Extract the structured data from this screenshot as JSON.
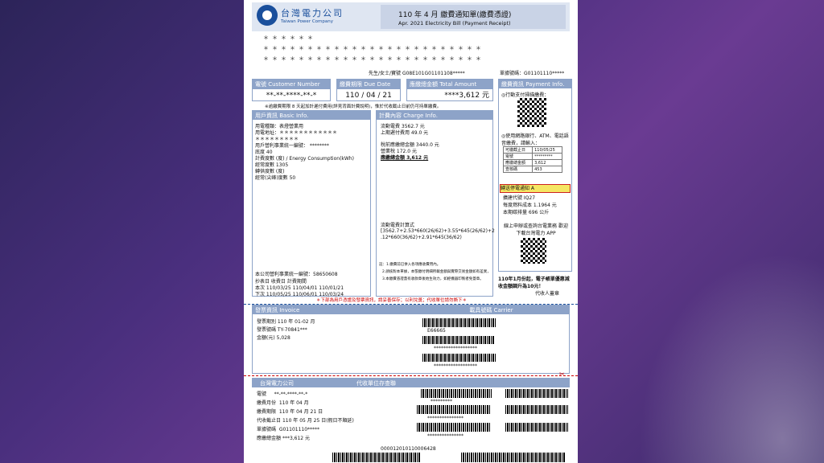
{
  "company": {
    "name_zh": "台灣電力公司",
    "name_en": "Taiwan Power Company"
  },
  "header": {
    "line1": "110 年  4 月      繳費通知單(繳費憑證)",
    "line2": "Apr. 2021 Electricity Bill (Payment Receipt)"
  },
  "stars_row1": "＊＊＊＊＊＊",
  "stars_row2": "＊＊＊＊＊＊＊＊＊＊＊＊＊＊＊＊＊＊＊＊＊＊＊＊＊",
  "stars_row3": "＊＊＊＊＊＊＊＊＊＊＊＊＊＊＊＊＊＊＊＊＊＊＊＊＊",
  "customer_line": "先生/女士/寶號   G08E101G01101108*****",
  "bill_no": "單據號碼：G01101110*****",
  "top_fields": {
    "account_label": "電號 Customer Number",
    "account_value": "**-**-****-**-*",
    "due_label": "繳費期限 Due Date",
    "due_value": "110 / 04 / 21",
    "total_label": "應繳總金額 Total Amount",
    "total_value": "****3,612 元"
  },
  "notice": "※逾繳費期限 8 天起加計遲付費用(詳見背面計費說明)，惟於代收截止日前仍可持單繳費。",
  "basic": {
    "title": "用戶資訊 Basic Info.",
    "rows": [
      "用電種類：表燈營業用",
      "用電地址：＊＊＊＊＊＊＊＊＊＊＊＊",
      "＊＊＊＊＊＊＊＊＊",
      "用戶營利事業統一編號：    ********",
      "底度                               40",
      "計費度數 (度) / Energy Consumption(kWh)",
      "  經常度數                        1305",
      "轉供度數 (度)",
      "  經常(尖峰)度數                    50"
    ],
    "tax_id": "本公司營利事業統一編號：58650608",
    "table_head": "        抄表日      收費日      計費期間",
    "table_r1": "本次   110/03/25   110/04/01   110/01/21",
    "table_r2": "下次   110/05/25   110/06/01   110/03/24"
  },
  "charge": {
    "title": "計費內容 Charge Info.",
    "rows": [
      "流動電費                 3562.7 元",
      "上期遲付費用                 49.0 元",
      "稅前應繳總金額           3440.0 元",
      "營業稅                    172.0 元",
      "應繳總金額                3,612 元"
    ],
    "formula_title": "流動電費計算式",
    "formula": [
      "[3562.7+2.53*660(26/62)+3.55*645(26/62)+2",
      ".12*660(36/62)+2.91*645(36/62)"
    ],
    "notes": [
      "註：1.繳費前已併入各項應收費用內。",
      "2.請核對本單據，本張繳付明細所載金額與實際交易金額如有差異，",
      "3.本繳費憑證蓋有收款章後始生效力，如經機器印製者免蓋章。"
    ]
  },
  "payment": {
    "title": "繳費資訊 Payment Info.",
    "mobile": "◎行動支付掃描繳費：",
    "bank": "◎使用網路銀行、ATM、電話語音繳費，請輸入：",
    "table": [
      [
        "可繳截止日",
        "110/05/25"
      ],
      [
        "電號",
        "*********"
      ],
      [
        "應繳總金額",
        "3,612"
      ],
      [
        "查核碼",
        "453"
      ]
    ],
    "highlight": "轉送停電通知      A",
    "r1": "擴建代號               IQ27",
    "r2": "每度燃料成本       1.1964 元",
    "r3": "本期碳排量           696 公斤",
    "app": "線上申辦或查詢台電業務 歡迎下載台灣電力 APP",
    "promo": "110年1月份起，電子帳單優惠減收金額調升為10元！",
    "stamp": "代收人蓋章"
  },
  "warning_red": "＊下部為用戶憑證及發票資訊，請妥善保存；以利兌獎；代收單位請勿撕下＊",
  "invoice": {
    "title": "發票資訊 Invoice",
    "carrier": "載具號碼 Carrier",
    "rows": [
      "發票期別      110 年 01-02 月",
      "發票號碼      TY-70841***",
      "金額(元)      5,028"
    ],
    "code1": "E66665",
    "stars": "******************"
  },
  "stub": {
    "title": "代收單位存查聯",
    "rows": [
      [
        "電號",
        "**-**-****-**-*"
      ],
      [
        "繳費月份",
        "110 年 04 月"
      ],
      [
        "繳費期限",
        "110 年 04 月 21 日"
      ],
      [
        "代收截止日",
        "110 年 05 月 25 日(假日不順延)"
      ],
      [
        "單據號碼",
        "G01101110*****"
      ],
      [
        "應繳總金額",
        "***3,612 元"
      ]
    ],
    "bottom_code": "000012010110006428",
    "stars_a": "*********",
    "stars_b": "***************"
  }
}
